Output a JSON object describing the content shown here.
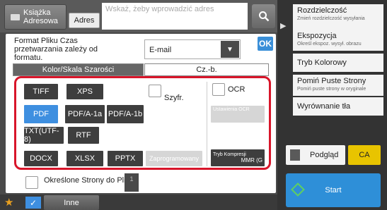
{
  "topbar": {
    "address_book_label": "Książka Adresowa",
    "adres_label": "Adres",
    "address_placeholder": "Wskaż, żeby wprowadzić adres"
  },
  "format": {
    "label": "Format Pliku Czas przetwarzania zależy od formatu.",
    "selected": "E-mail",
    "ok_label": "OK"
  },
  "tabs": {
    "color_gray": "Kolor/Skala Szarości",
    "bw": "Cz.-b."
  },
  "formats": {
    "tiff": "TIFF",
    "xps": "XPS",
    "pdf": "PDF",
    "pdfa1a": "PDF/A-1a",
    "pdfa1b": "PDF/A-1b",
    "txt": "TXT(UTF-8)",
    "rtf": "RTF",
    "docx": "DOCX",
    "xlsx": "XLSX",
    "pptx": "PPTX",
    "programmed": "Zaprogramowany"
  },
  "options": {
    "encrypt": "Szyfr.",
    "ocr": "OCR",
    "ocr_settings": "Ustawienia OCR",
    "compression": "Tryb Kompresji",
    "compression_value": "MMR (G"
  },
  "pages": {
    "label": "Określone Strony do Pliku",
    "value": "1"
  },
  "footer": {
    "other_label": "Inne"
  },
  "right_panel": {
    "items": [
      {
        "title": "Rozdzielczość",
        "sub": "Zmień rozdzielczość wysyłania"
      },
      {
        "title": "Ekspozycja",
        "sub": "Określ ekspoz. wysył. obrazu"
      },
      {
        "title": "Tryb Kolorowy",
        "sub": ""
      },
      {
        "title": "Pomiń Puste Strony",
        "sub": "Pomiń puste strony w oryginale"
      },
      {
        "title": "Wyrównanie tła",
        "sub": ""
      }
    ],
    "preview_label": "Podgląd",
    "ca_label": "CA",
    "start_label": "Start"
  },
  "colors": {
    "accent_blue": "#3e8fe0",
    "frame_red": "#d8152a",
    "ca_yellow": "#e8c400"
  }
}
